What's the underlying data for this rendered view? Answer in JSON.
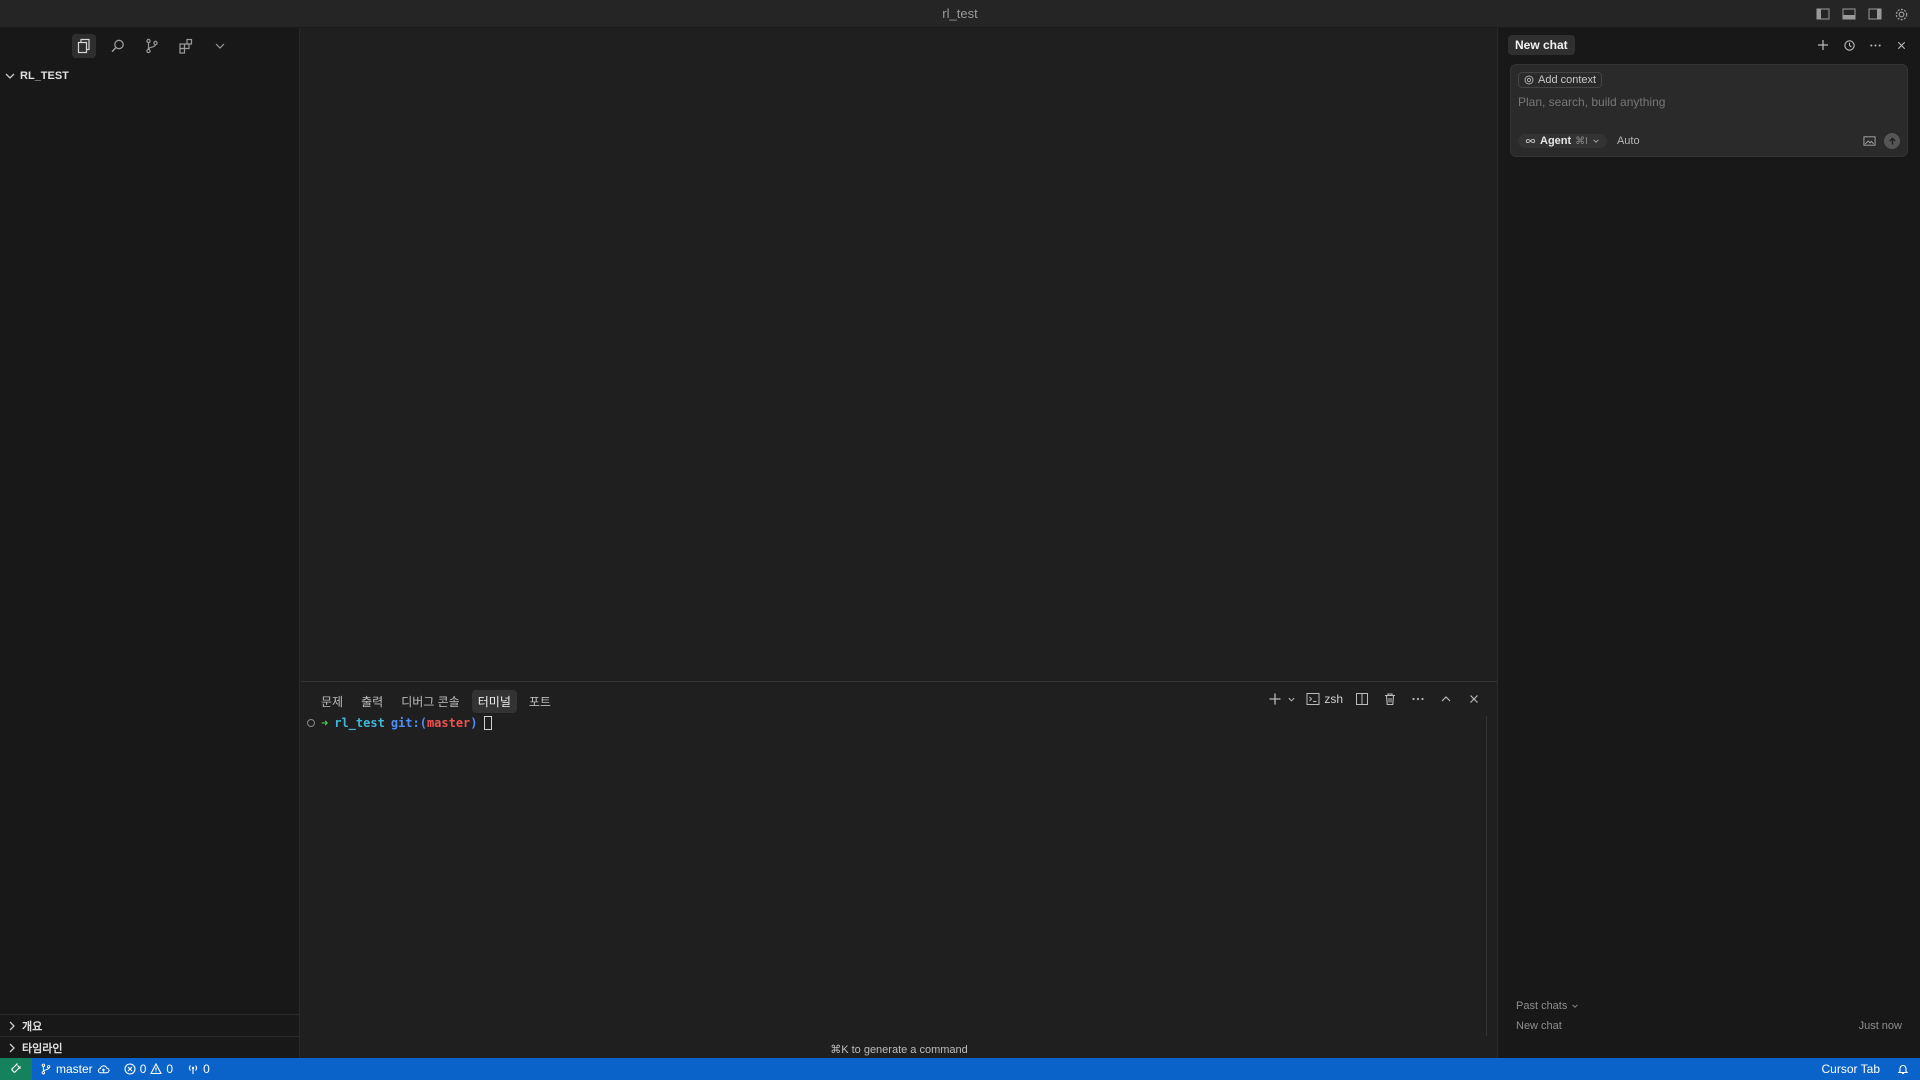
{
  "window": {
    "title": "rl_test"
  },
  "sidebar": {
    "explorer_title": "RL_TEST",
    "sections": [
      {
        "label": "개요"
      },
      {
        "label": "타임라인"
      }
    ]
  },
  "panel": {
    "tabs": [
      {
        "label": "문제"
      },
      {
        "label": "출력"
      },
      {
        "label": "디버그 콘솔"
      },
      {
        "label": "터미널",
        "active": true
      },
      {
        "label": "포트"
      }
    ],
    "shell_label": "zsh",
    "terminal": {
      "arrow": "➜",
      "dir": "rl_test",
      "git_prefix": "git:(",
      "branch": "master",
      "git_suffix": ")"
    },
    "hint": "⌘K to generate a command"
  },
  "chat": {
    "tab_label": "New chat",
    "add_context_label": "Add context",
    "input_placeholder": "Plan, search, build anything",
    "mode_label": "Agent",
    "mode_shortcut": "⌘I",
    "model_label": "Auto",
    "past_chats_label": "Past chats",
    "history": [
      {
        "title": "New chat",
        "time": "Just now"
      }
    ]
  },
  "statusbar": {
    "branch": "master",
    "errors": "0",
    "warnings": "0",
    "ports": "0",
    "right_label": "Cursor Tab"
  },
  "colors": {
    "statusbar_bg": "#0a63c9",
    "remote_bg": "#16825d",
    "terminal_dir": "#3fb8d9",
    "terminal_branch": "#f05252"
  }
}
